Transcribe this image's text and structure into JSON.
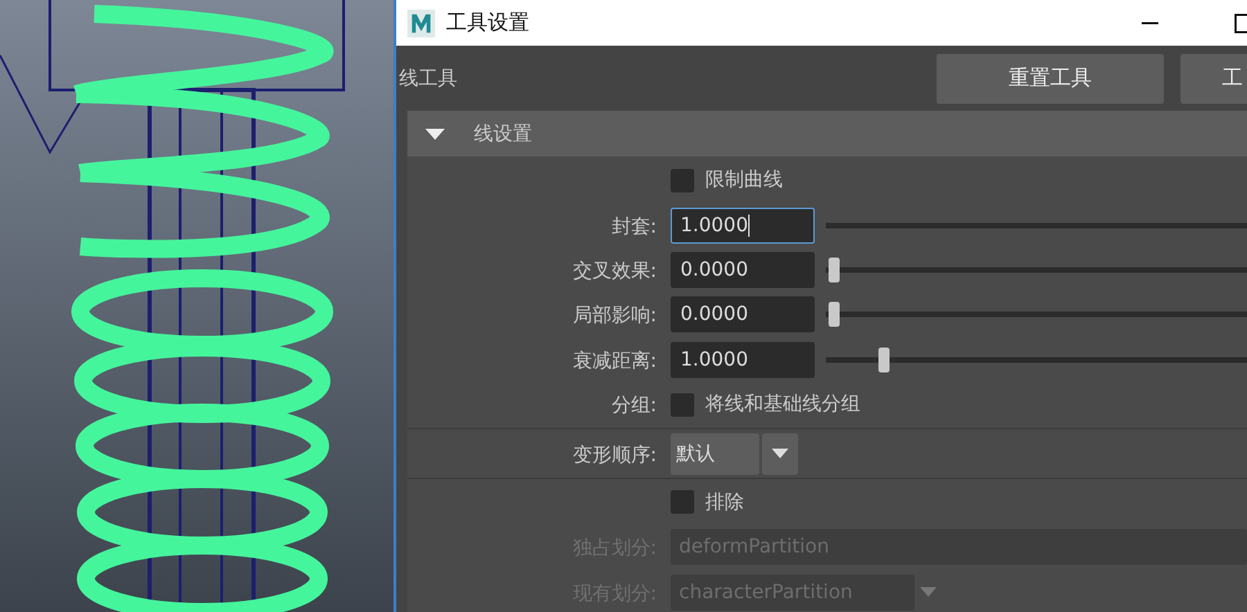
{
  "window": {
    "title": "工具设置"
  },
  "toolbar": {
    "tool_name": "线工具",
    "buttons": [
      "重置工具",
      "工"
    ]
  },
  "section": {
    "title": "线设置",
    "expanded": true
  },
  "groups": [
    [
      {
        "kind": "checkbox",
        "text": "限制曲线",
        "checked": false
      },
      {
        "kind": "slider",
        "label": "封套:",
        "value": "1.0000",
        "focused": true
      },
      {
        "kind": "slider",
        "label": "交叉效果:",
        "value": "0.0000",
        "focused": false,
        "level": 0
      },
      {
        "kind": "slider",
        "label": "局部影响:",
        "value": "0.0000",
        "focused": false,
        "level": 0
      },
      {
        "kind": "slider",
        "label": "衰减距离:",
        "value": "1.0000",
        "focused": false,
        "level": 0.11
      },
      {
        "kind": "checkbox",
        "label": "分组:",
        "text": "将线和基础线分组",
        "checked": false
      }
    ],
    [
      {
        "kind": "dropdown",
        "label": "变形顺序:",
        "value": "默认"
      }
    ],
    [
      {
        "kind": "checkbox",
        "text": "排除",
        "checked": false
      },
      {
        "kind": "field",
        "label": "独占划分:",
        "value": "deformPartition",
        "disabled": true
      },
      {
        "kind": "combo",
        "label": "现有划分:",
        "value": "characterPartition",
        "disabled": true
      }
    ]
  ]
}
